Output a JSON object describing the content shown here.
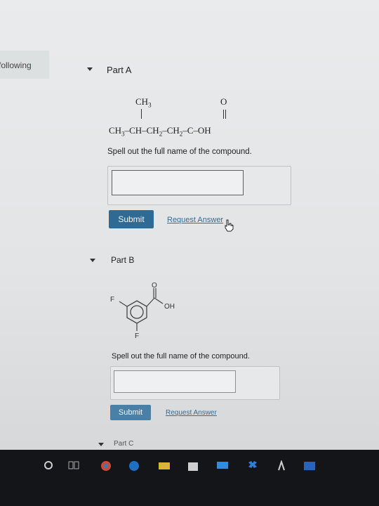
{
  "sidebar": {
    "partial_text": "following"
  },
  "part_a": {
    "label": "Part A",
    "formula": {
      "branch": "CH3",
      "carbonyl_o": "O",
      "main_chain": "CH3–CH–CH2–CH2–C–OH"
    },
    "prompt": "Spell out the full name of the compound.",
    "input_value": "",
    "submit_label": "Submit",
    "request_label": "Request Answer"
  },
  "part_b": {
    "label": "Part B",
    "structure": {
      "f_left": "F",
      "f_bottom": "F",
      "o_top": "O",
      "oh": "OH"
    },
    "prompt": "Spell out the full name of the compound.",
    "input_value": "",
    "submit_label": "Submit",
    "request_label": "Request Answer"
  },
  "part_c": {
    "label": "Part C"
  },
  "taskbar": {
    "icons": [
      "cortana-icon",
      "task-view-icon",
      "chrome-icon",
      "edge-icon",
      "file-explorer-icon",
      "store-icon",
      "mail-icon",
      "dropbox-icon",
      "app-icon",
      "photos-icon"
    ]
  }
}
